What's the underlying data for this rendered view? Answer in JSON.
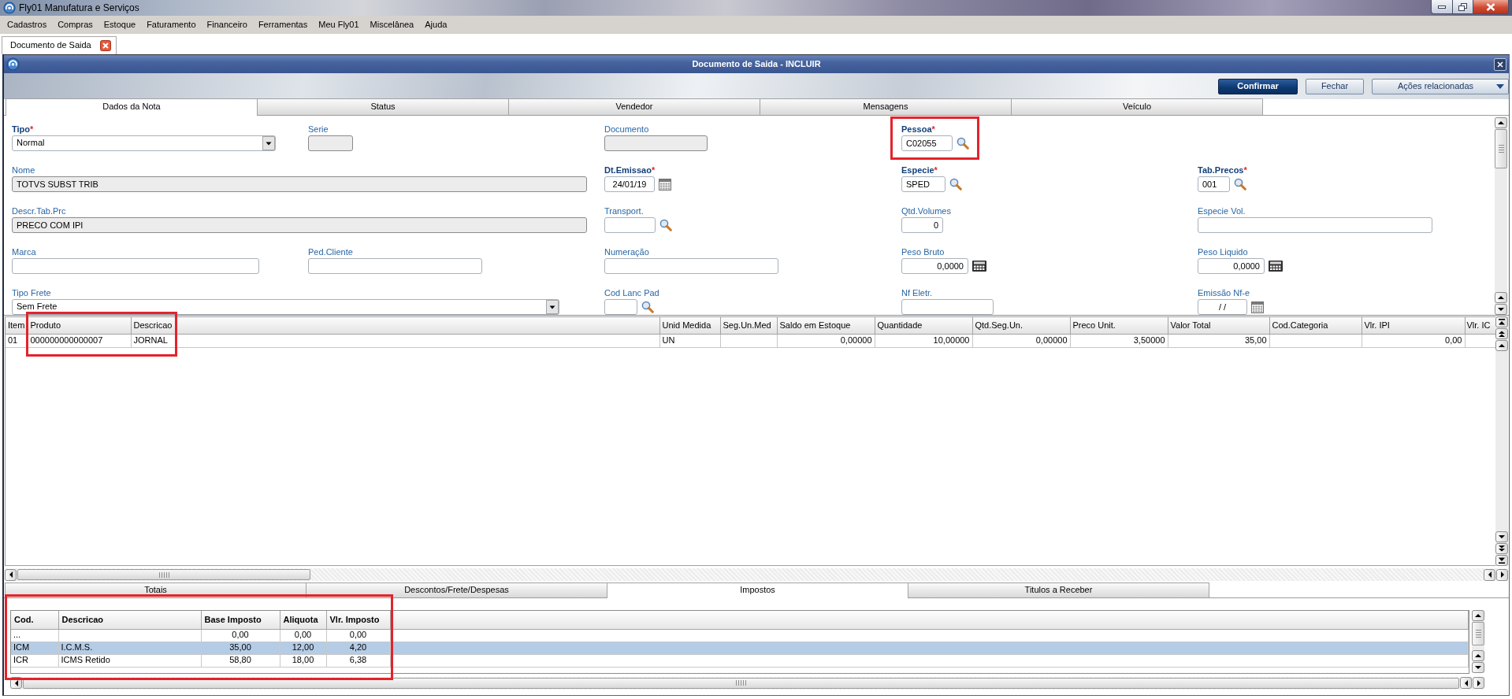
{
  "app": {
    "title": "Fly01 Manufatura e Serviços"
  },
  "menu": [
    "Cadastros",
    "Compras",
    "Estoque",
    "Faturamento",
    "Financeiro",
    "Ferramentas",
    "Meu Fly01",
    "Miscelânea",
    "Ajuda"
  ],
  "document_tabs": [
    {
      "label": "Documento de Saida",
      "selected": true
    }
  ],
  "window": {
    "title": "Documento de Saida - INCLUIR"
  },
  "actions": [
    {
      "label": "Confirmar",
      "kind": "primary"
    },
    {
      "label": "Fechar",
      "kind": "plain"
    },
    {
      "label": "Ações relacionadas",
      "kind": "menu"
    }
  ],
  "tabs": [
    {
      "label": "Dados da Nota",
      "selected": true
    },
    {
      "label": "Status",
      "selected": false
    },
    {
      "label": "Vendedor",
      "selected": false
    },
    {
      "label": "Mensagens",
      "selected": false
    },
    {
      "label": "Veículo",
      "selected": false
    }
  ],
  "fields": [
    {
      "label": "Tipo",
      "required": true,
      "required_mark": "*",
      "kind": "select",
      "readonly": false,
      "highlighted": false,
      "value": "Normal"
    },
    {
      "label": "Serie",
      "required": false,
      "kind": "text",
      "readonly": true,
      "highlighted": false
    },
    {
      "label": "Documento",
      "required": false,
      "kind": "text",
      "readonly": true,
      "highlighted": false
    },
    {
      "label": "Pessoa",
      "required": true,
      "required_mark": "*",
      "kind": "lookup",
      "readonly": false,
      "highlighted": true,
      "value": "C02055"
    },
    {
      "label": "Nome",
      "required": false,
      "kind": "text",
      "readonly": true,
      "highlighted": false,
      "value": "TOTVS SUBST TRIB"
    },
    {
      "label": "Dt.Emissao",
      "required": true,
      "required_mark": "*",
      "kind": "date",
      "readonly": false,
      "highlighted": false,
      "value": "24/01/19"
    },
    {
      "label": "Especie",
      "required": true,
      "required_mark": "*",
      "kind": "lookup",
      "readonly": false,
      "highlighted": false,
      "value": "SPED"
    },
    {
      "label": "Tab.Precos",
      "required": true,
      "required_mark": "*",
      "kind": "lookup",
      "readonly": false,
      "highlighted": false,
      "value": "001"
    },
    {
      "label": "Descr.Tab.Prc",
      "required": false,
      "kind": "text",
      "readonly": true,
      "highlighted": false,
      "value": "PRECO COM IPI"
    },
    {
      "label": "Transport.",
      "required": false,
      "kind": "lookup",
      "readonly": false,
      "highlighted": false
    },
    {
      "label": "Qtd.Volumes",
      "required": false,
      "kind": "number",
      "readonly": false,
      "highlighted": false,
      "value": "0"
    },
    {
      "label": "Especie Vol.",
      "required": false,
      "kind": "text",
      "readonly": false,
      "highlighted": false
    },
    {
      "label": "Marca",
      "required": false,
      "kind": "text",
      "readonly": false,
      "highlighted": false
    },
    {
      "label": "Ped.Cliente",
      "required": false,
      "kind": "text",
      "readonly": false,
      "highlighted": false
    },
    {
      "label": "Numeração",
      "required": false,
      "kind": "text",
      "readonly": false,
      "highlighted": false
    },
    {
      "label": "Peso Bruto",
      "required": false,
      "kind": "calc",
      "readonly": false,
      "highlighted": false,
      "value": "0,0000"
    },
    {
      "label": "Peso Liquido",
      "required": false,
      "kind": "calc",
      "readonly": false,
      "highlighted": false,
      "value": "0,0000"
    },
    {
      "label": "Tipo Frete",
      "required": false,
      "kind": "select",
      "readonly": false,
      "highlighted": false,
      "value": "Sem Frete"
    },
    {
      "label": "Cod Lanc Pad",
      "required": false,
      "kind": "lookup",
      "readonly": false,
      "highlighted": false
    },
    {
      "label": "Nf Eletr.",
      "required": false,
      "kind": "text",
      "readonly": false,
      "highlighted": false
    },
    {
      "label": "Emissão Nf-e",
      "required": false,
      "kind": "date",
      "readonly": false,
      "highlighted": false,
      "value": "/ /"
    }
  ],
  "items_grid": {
    "columns": [
      {
        "label": "Item",
        "kind": "text",
        "highlighted": false
      },
      {
        "label": "Produto",
        "kind": "text",
        "highlighted": true
      },
      {
        "label": "Descricao",
        "kind": "text",
        "highlighted": true
      },
      {
        "label": "Unid Medida",
        "kind": "text",
        "highlighted": false
      },
      {
        "label": "Seg.Un.Med",
        "kind": "text",
        "highlighted": false
      },
      {
        "label": "Saldo em Estoque",
        "kind": "number",
        "highlighted": false
      },
      {
        "label": "Quantidade",
        "kind": "number",
        "highlighted": false
      },
      {
        "label": "Qtd.Seg.Un.",
        "kind": "number",
        "highlighted": false
      },
      {
        "label": "Preco Unit.",
        "kind": "number",
        "highlighted": false
      },
      {
        "label": "Valor Total",
        "kind": "number",
        "highlighted": false
      },
      {
        "label": "Cod.Categoria",
        "kind": "text",
        "highlighted": false
      },
      {
        "label": "Vlr. IPI",
        "kind": "number",
        "highlighted": false
      },
      {
        "label": "Vlr. IC",
        "kind": "number",
        "highlighted": false
      }
    ],
    "rows": [
      {
        "selected": false,
        "cells": [
          "01",
          "000000000000007",
          "JORNAL",
          "UN",
          null,
          "0,00000",
          "10,00000",
          "0,00000",
          "3,50000",
          "35,00",
          null,
          "0,00",
          null
        ]
      }
    ]
  },
  "bottom_tabs": [
    {
      "label": "Totais",
      "selected": false
    },
    {
      "label": "Descontos/Frete/Despesas",
      "selected": false
    },
    {
      "label": "Impostos",
      "selected": true
    },
    {
      "label": "Titulos a Receber",
      "selected": false
    }
  ],
  "taxes": {
    "highlighted": true,
    "columns": [
      {
        "label": "Cod.",
        "kind": "text"
      },
      {
        "label": "Descricao",
        "kind": "text"
      },
      {
        "label": "Base Imposto",
        "kind": "number"
      },
      {
        "label": "Aliquota",
        "kind": "number"
      },
      {
        "label": "Vlr. Imposto",
        "kind": "number"
      }
    ],
    "rows": [
      {
        "selected": false,
        "cells": [
          "...",
          null,
          "0,00",
          "0,00",
          "0,00"
        ]
      },
      {
        "selected": true,
        "cells": [
          "ICM",
          "I.C.M.S.",
          "35,00",
          "12,00",
          "4,20"
        ]
      },
      {
        "selected": false,
        "cells": [
          "ICR",
          "ICMS Retido",
          "58,80",
          "18,00",
          "6,38"
        ]
      }
    ]
  }
}
